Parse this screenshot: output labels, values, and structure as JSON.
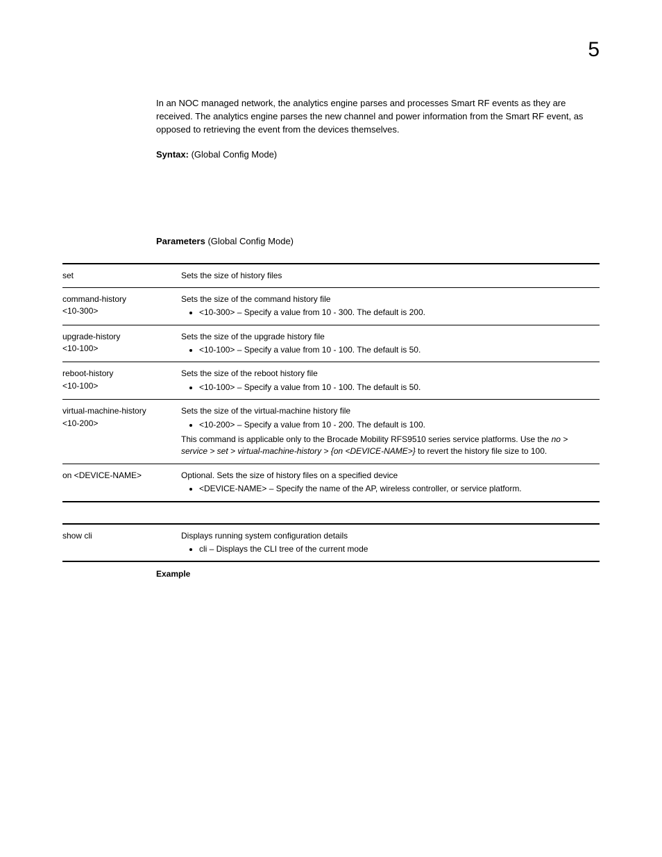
{
  "chapter_number": "5",
  "intro_para": "In an NOC managed network, the analytics engine parses and processes Smart RF events as they are received. The analytics engine parses the new channel and power information from the Smart RF event, as opposed to retrieving the event from the devices themselves.",
  "syntax_label": "Syntax:",
  "syntax_value": "  (Global Config Mode)",
  "params_label": "Parameters",
  "params_suffix": " (Global Config Mode)",
  "t1": {
    "r0": {
      "c1": "set",
      "desc": "Sets the size of history files"
    },
    "r1": {
      "c1a": "command-history",
      "c1b": "<10-300>",
      "desc": "Sets the size of the command history file",
      "b1": "<10-300> – Specify a value from 10 - 300. The default is 200."
    },
    "r2": {
      "c1a": "upgrade-history",
      "c1b": "<10-100>",
      "desc": "Sets the size of the upgrade history file",
      "b1": "<10-100> – Specify a value from 10 - 100. The default is 50."
    },
    "r3": {
      "c1a": "reboot-history",
      "c1b": "<10-100>",
      "desc": "Sets the size of the reboot history file",
      "b1": "<10-100> – Specify a value from 10 - 100. The default is 50."
    },
    "r4": {
      "c1a": "virtual-machine-history",
      "c1b": "<10-200>",
      "desc": "Sets the size of the virtual-machine history file",
      "b1": "<10-200> – Specify a value from 10 - 200. The default is 100.",
      "note_pre": "This command is applicable only to the Brocade Mobility RFS9510 series service platforms. Use the ",
      "note_ital": "no > service > set > virtual-machine-history > {on <DEVICE-NAME>}",
      "note_post": " to revert the history file size to 100."
    },
    "r5": {
      "c1": "on <DEVICE-NAME>",
      "desc": "Optional. Sets the size of history files on a specified device",
      "b1": "<DEVICE-NAME> – Specify the name of the AP, wireless controller, or service platform."
    }
  },
  "t2": {
    "r0": {
      "c1": "show cli",
      "desc": "Displays running system configuration details",
      "b1": "cli – Displays the CLI tree of the current mode"
    }
  },
  "example_label": "Example"
}
